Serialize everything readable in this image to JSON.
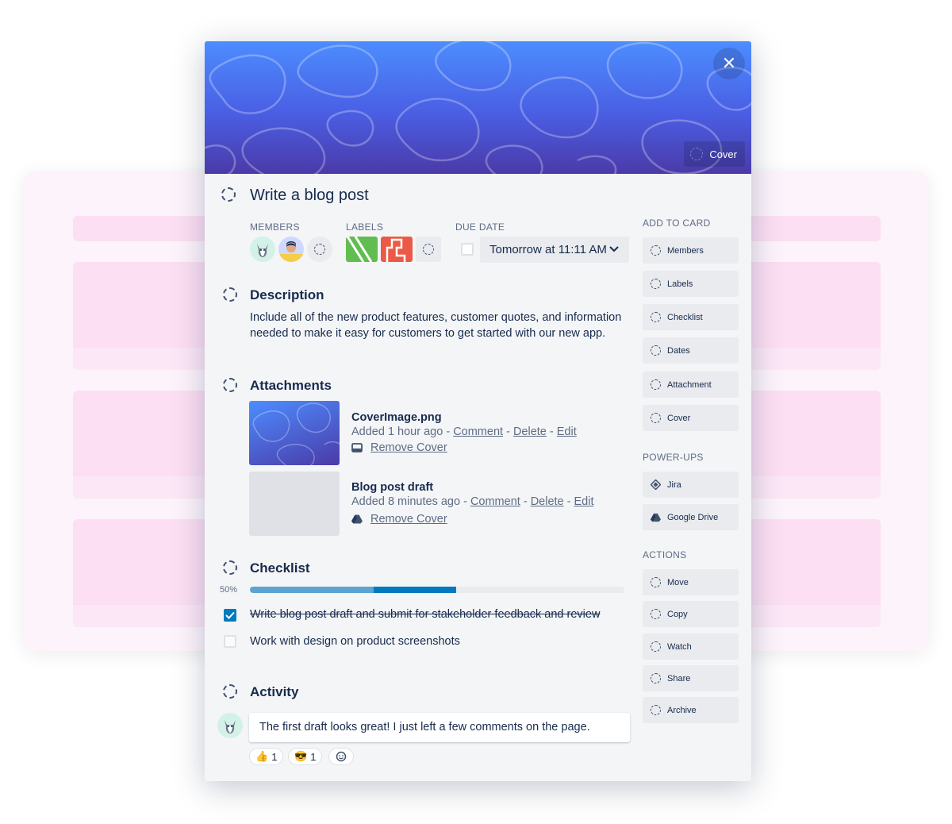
{
  "card": {
    "title": "Write a blog post",
    "cover_button_label": "Cover",
    "close_symbol": "✕"
  },
  "meta": {
    "members_label": "MEMBERS",
    "labels_label": "LABELS",
    "due_label": "DUE DATE",
    "due_value": "Tomorrow at 11:11 AM",
    "label_colors": [
      "#61bd4f",
      "#eb5a46"
    ]
  },
  "description": {
    "heading": "Description",
    "text": "Include all of the new product features, customer quotes, and information needed to make it easy for customers to get started with our new app."
  },
  "attachments": {
    "heading": "Attachments",
    "items": [
      {
        "name": "CoverImage.png",
        "added": "Added 1 hour ago",
        "comment": "Comment",
        "delete": "Delete",
        "edit": "Edit",
        "remove_cover": "Remove Cover",
        "icon": "image-icon"
      },
      {
        "name": "Blog post draft",
        "added": "Added 8 minutes ago",
        "comment": "Comment",
        "delete": "Delete",
        "edit": "Edit",
        "remove_cover": "Remove Cover",
        "icon": "google-drive-icon"
      }
    ],
    "separator": " - "
  },
  "checklist": {
    "heading": "Checklist",
    "percent_label": "50%",
    "progress": 0.5,
    "items": [
      {
        "text": "Write blog post draft and submit for stakeholder feedback and review",
        "checked": true
      },
      {
        "text": "Work with design on product screenshots",
        "checked": false
      }
    ]
  },
  "activity": {
    "heading": "Activity",
    "comment": "The first draft looks great! I just left a few comments on the page.",
    "reactions": [
      {
        "emoji": "👍",
        "count": "1"
      },
      {
        "emoji": "😎",
        "count": "1"
      }
    ]
  },
  "sidebar": {
    "add_to_card_label": "ADD TO CARD",
    "add_items": [
      "Members",
      "Labels",
      "Checklist",
      "Dates",
      "Attachment",
      "Cover"
    ],
    "powerups_label": "POWER-UPS",
    "powerups": [
      "Jira",
      "Google Drive"
    ],
    "actions_label": "ACTIONS",
    "actions": [
      "Move",
      "Copy",
      "Watch",
      "Share",
      "Archive"
    ]
  },
  "colors": {
    "accent": "#0079bf",
    "progress_light": "#5ba4cf",
    "cover_top": "#4c8dff",
    "cover_bottom": "#4b3aa8",
    "background_board": "#fdf3fb",
    "background_strip": "#fcdff3"
  }
}
